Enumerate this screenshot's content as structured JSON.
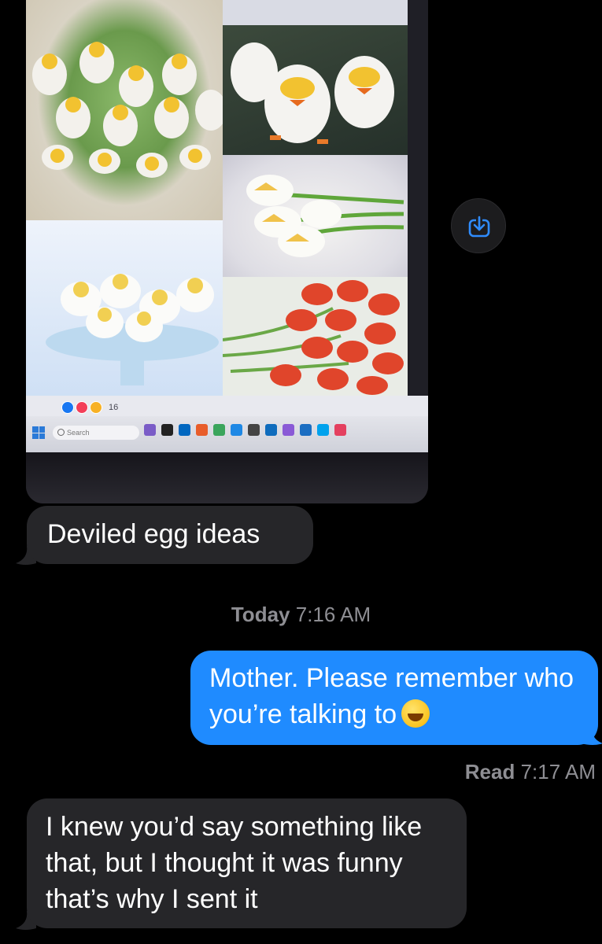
{
  "photo": {
    "reaction_count": "16",
    "taskbar_search_placeholder": "Search"
  },
  "messages": [
    {
      "id": "m1",
      "direction": "incoming",
      "text": "Deviled egg ideas"
    },
    {
      "id": "m2",
      "direction": "outgoing",
      "text": "Mother. Please remember who you’re talking to",
      "emoji": "rolling-on-floor-laughing"
    },
    {
      "id": "m3",
      "direction": "incoming",
      "text": "I knew you’d say something like that, but I thought it was funny that’s why I sent it"
    }
  ],
  "timestamp": {
    "day": "Today",
    "time": "7:16 AM"
  },
  "read_receipt": {
    "label": "Read",
    "time": "7:17 AM"
  },
  "colors": {
    "background": "#000000",
    "incoming_bubble": "#262629",
    "outgoing_bubble": "#1f8bff",
    "meta_text": "#8e8e93",
    "download_icon": "#2f8cff"
  },
  "icons": {
    "download": "save-download-icon"
  }
}
